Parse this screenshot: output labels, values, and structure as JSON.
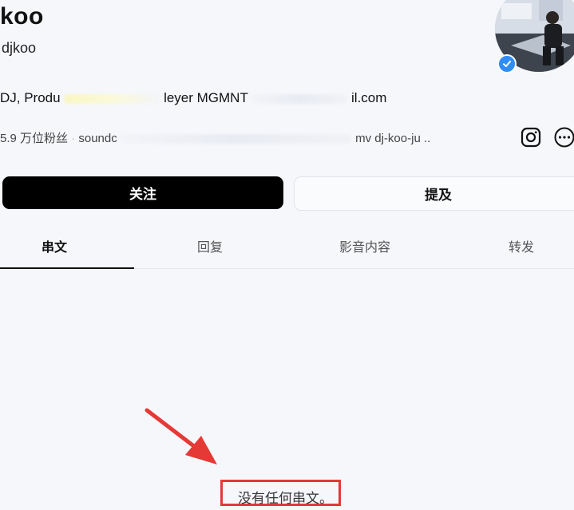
{
  "profile": {
    "name": "koo",
    "handle": "djkoo",
    "bio_prefix": "DJ, Produ",
    "bio_mid": "leyer MGMNT",
    "bio_suffix": "il.com",
    "followers": "5.9 万位粉丝",
    "link_prefix": "soundc",
    "link_suffix": "mv dj-koo-ju ..",
    "verified": true
  },
  "icons": {
    "instagram": "instagram-icon",
    "more": "more-options-icon",
    "verified": "verified-badge-icon"
  },
  "actions": {
    "follow_label": "关注",
    "mention_label": "提及"
  },
  "tabs": [
    {
      "label": "串文",
      "active": true
    },
    {
      "label": "回复",
      "active": false
    },
    {
      "label": "影音内容",
      "active": false
    },
    {
      "label": "转发",
      "active": false
    }
  ],
  "content": {
    "empty_message": "没有任何串文。"
  },
  "colors": {
    "annotation": "#e53935",
    "primary_button": "#000000",
    "verified": "#2f8df5"
  }
}
